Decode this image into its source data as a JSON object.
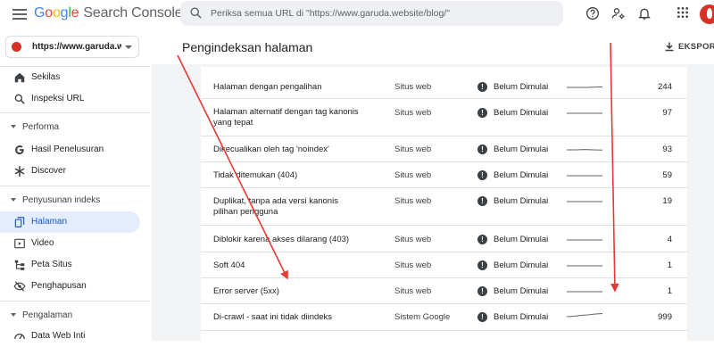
{
  "app": {
    "logo_google": "Google",
    "logo_product": "Search Console"
  },
  "search": {
    "placeholder": "Periksa semua URL di \"https://www.garuda.website/blog/\""
  },
  "top_icons": [
    "help-icon",
    "manage-users-icon",
    "notifications-icon",
    "apps-grid-icon"
  ],
  "sidebar": {
    "property": "https://www.garuda.we…",
    "items": [
      {
        "label": "Sekilas",
        "icon": "home-icon"
      },
      {
        "label": "Inspeksi URL",
        "icon": "search-icon"
      },
      {
        "label": "Performa",
        "section": true
      },
      {
        "label": "Hasil Penelusuran",
        "icon": "google-g-icon"
      },
      {
        "label": "Discover",
        "icon": "asterisk-icon"
      },
      {
        "label": "Penyusunan indeks",
        "section": true
      },
      {
        "label": "Halaman",
        "icon": "pages-icon",
        "active": true
      },
      {
        "label": "Video",
        "icon": "video-icon"
      },
      {
        "label": "Peta Situs",
        "icon": "sitemap-icon"
      },
      {
        "label": "Penghapusan",
        "icon": "removals-icon"
      },
      {
        "label": "Pengalaman",
        "section": true
      },
      {
        "label": "Data Web Inti",
        "icon": "speed-icon"
      }
    ]
  },
  "header": {
    "title": "Pengindeksan halaman",
    "export_label": "EKSPOR"
  },
  "table": {
    "rows": [
      {
        "reason": "Halaman dengan pengalihan",
        "source": "Situs web",
        "validation": "Belum Dimulai",
        "count": "244"
      },
      {
        "reason": "Halaman alternatif dengan tag kanonis yang tepat",
        "source": "Situs web",
        "validation": "Belum Dimulai",
        "count": "97"
      },
      {
        "reason": "Dikecualikan oleh tag 'noindex'",
        "source": "Situs web",
        "validation": "Belum Dimulai",
        "count": "93"
      },
      {
        "reason": "Tidak ditemukan (404)",
        "source": "Situs web",
        "validation": "Belum Dimulai",
        "count": "59"
      },
      {
        "reason": "Duplikat, tanpa ada versi kanonis pilihan pengguna",
        "source": "Situs web",
        "validation": "Belum Dimulai",
        "count": "19"
      },
      {
        "reason": "Diblokir karena akses dilarang (403)",
        "source": "Situs web",
        "validation": "Belum Dimulai",
        "count": "4"
      },
      {
        "reason": "Soft 404",
        "source": "Situs web",
        "validation": "Belum Dimulai",
        "count": "1"
      },
      {
        "reason": "Error server (5xx)",
        "source": "Situs web",
        "validation": "Belum Dimulai",
        "count": "1"
      },
      {
        "reason": "Di-crawl - saat ini tidak diindeks",
        "source": "Sistem Google",
        "validation": "Belum Dimulai",
        "count": "999"
      }
    ]
  },
  "colors": {
    "accent": "#1a56c4",
    "active_bg": "#e3edfd",
    "annotation_arrow": "#e53935",
    "brand_avatar": "#d93025"
  }
}
